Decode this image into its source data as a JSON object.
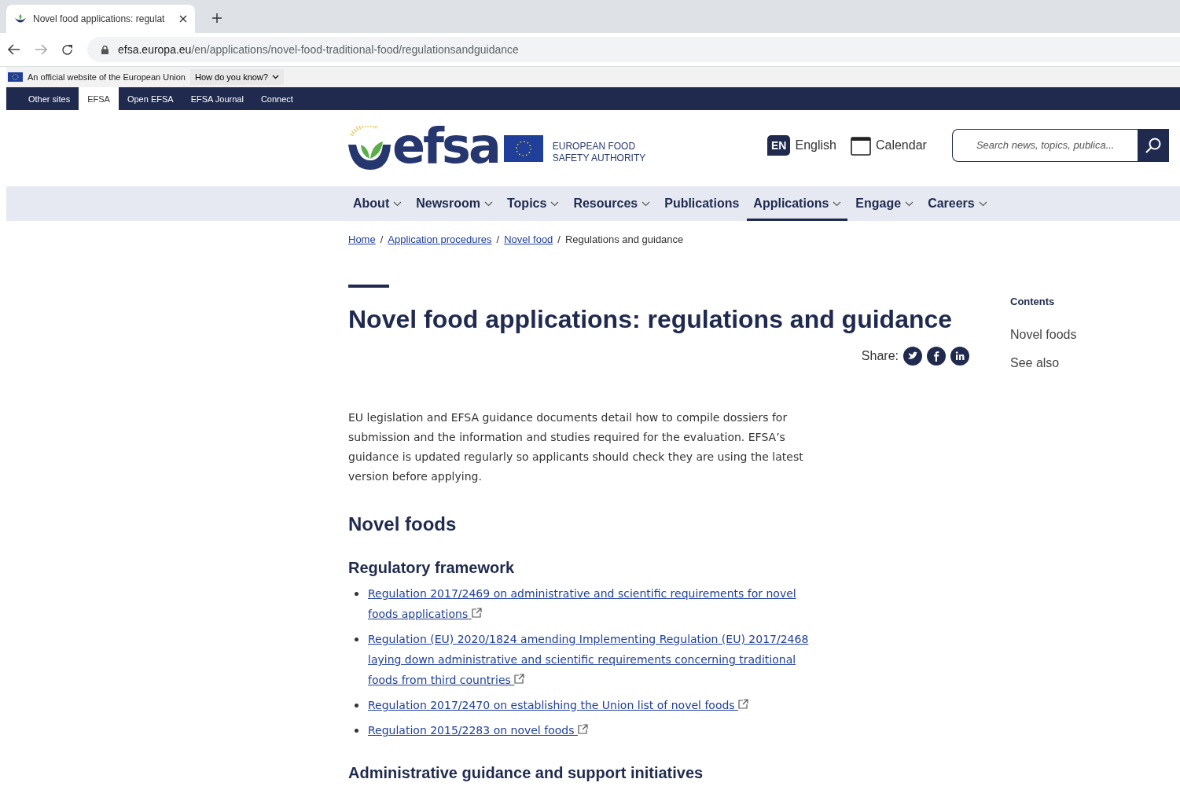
{
  "browser": {
    "tab_title": "Novel food applications: regulat",
    "url_host": "efsa.europa.eu",
    "url_path": "/en/applications/novel-food-traditional-food/regulationsandguidance"
  },
  "eu_banner": {
    "text": "An official website of the European Union",
    "toggle": "How do you know?"
  },
  "site_switcher": [
    {
      "label": "Other sites",
      "selected": false
    },
    {
      "label": "EFSA",
      "selected": true
    },
    {
      "label": "Open EFSA",
      "selected": false
    },
    {
      "label": "EFSA Journal",
      "selected": false
    },
    {
      "label": "Connect",
      "selected": false
    }
  ],
  "header": {
    "logo_text": "efsa",
    "org_line_1": "EUROPEAN FOOD",
    "org_line_2": "SAFETY AUTHORITY",
    "lang_code": "EN",
    "lang_name": "English",
    "calendar": "Calendar",
    "search_placeholder": "Search news, topics, publica..."
  },
  "nav": [
    {
      "label": "About",
      "dropdown": true,
      "selected": false
    },
    {
      "label": "Newsroom",
      "dropdown": true,
      "selected": false
    },
    {
      "label": "Topics",
      "dropdown": true,
      "selected": false
    },
    {
      "label": "Resources",
      "dropdown": true,
      "selected": false
    },
    {
      "label": "Publications",
      "dropdown": false,
      "selected": false
    },
    {
      "label": "Applications",
      "dropdown": true,
      "selected": true
    },
    {
      "label": "Engage",
      "dropdown": true,
      "selected": false
    },
    {
      "label": "Careers",
      "dropdown": true,
      "selected": false
    }
  ],
  "breadcrumb": [
    {
      "label": "Home",
      "link": true
    },
    {
      "separator": "/",
      "label": "Application procedures",
      "link": true
    },
    {
      "separator": "/",
      "label": "Novel food",
      "link": true
    },
    {
      "separator": "/",
      "label": "Regulations and guidance",
      "link": false
    }
  ],
  "page": {
    "title": "Novel food applications: regulations and guidance",
    "share_label": "Share:",
    "intro": "EU legislation and EFSA guidance documents detail how to compile dossiers for submission and the information and studies required for the evaluation. EFSA’s guidance is updated regularly so applicants should check they are using the latest version before applying.",
    "section_heading": "Novel foods",
    "subheading": "Regulatory framework",
    "links": [
      "Regulation 2017/2469 on administrative and scientific requirements for novel foods applications",
      "Regulation (EU) 2020/1824 amending Implementing Regulation (EU) 2017/2468 laying down administrative and scientific requirements concerning traditional foods from third countries",
      "Regulation 2017/2470 on establishing the Union list of novel foods",
      "Regulation 2015/2283 on novel foods"
    ],
    "next_subheading": "Administrative guidance and support initiatives"
  },
  "contents": {
    "heading": "Contents",
    "items": [
      "Novel foods",
      "See also"
    ]
  }
}
